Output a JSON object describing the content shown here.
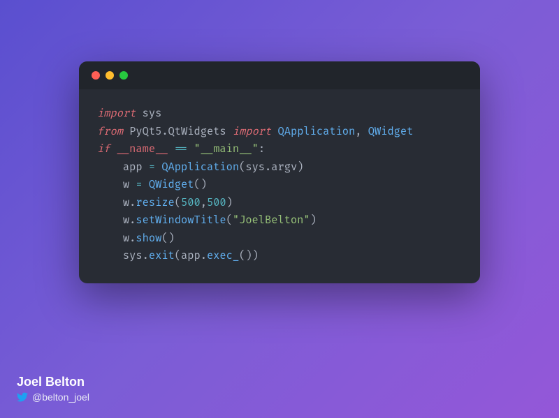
{
  "code": {
    "lines": [
      [
        {
          "t": "import",
          "c": "tok-kw"
        },
        {
          "t": " sys",
          "c": "tok-mod"
        }
      ],
      [
        {
          "t": "from",
          "c": "tok-kw"
        },
        {
          "t": " PyQt5.QtWidgets ",
          "c": "tok-mod"
        },
        {
          "t": "import",
          "c": "tok-kw"
        },
        {
          "t": " ",
          "c": "tok-mod"
        },
        {
          "t": "QApplication",
          "c": "tok-cls"
        },
        {
          "t": ", ",
          "c": "tok-punc"
        },
        {
          "t": "QWidget",
          "c": "tok-cls"
        }
      ],
      [
        {
          "t": "if",
          "c": "tok-kw"
        },
        {
          "t": " ",
          "c": "tok-mod"
        },
        {
          "t": "__name__",
          "c": "tok-dund"
        },
        {
          "t": " ",
          "c": "tok-mod"
        },
        {
          "t": "==",
          "c": "tok-op"
        },
        {
          "t": " ",
          "c": "tok-mod"
        },
        {
          "t": "\"__main__\"",
          "c": "tok-str"
        },
        {
          "t": ":",
          "c": "tok-punc"
        }
      ],
      [
        {
          "t": "    app ",
          "c": "tok-var"
        },
        {
          "t": "=",
          "c": "tok-op"
        },
        {
          "t": " ",
          "c": "tok-mod"
        },
        {
          "t": "QApplication",
          "c": "tok-cls"
        },
        {
          "t": "(sys.argv)",
          "c": "tok-punc"
        }
      ],
      [
        {
          "t": "    w ",
          "c": "tok-var"
        },
        {
          "t": "=",
          "c": "tok-op"
        },
        {
          "t": " ",
          "c": "tok-mod"
        },
        {
          "t": "QWidget",
          "c": "tok-cls"
        },
        {
          "t": "()",
          "c": "tok-punc"
        }
      ],
      [
        {
          "t": "    w.",
          "c": "tok-var"
        },
        {
          "t": "resize",
          "c": "tok-fn"
        },
        {
          "t": "(",
          "c": "tok-punc"
        },
        {
          "t": "500",
          "c": "tok-num"
        },
        {
          "t": ",",
          "c": "tok-punc"
        },
        {
          "t": "500",
          "c": "tok-num"
        },
        {
          "t": ")",
          "c": "tok-punc"
        }
      ],
      [
        {
          "t": "    w.",
          "c": "tok-var"
        },
        {
          "t": "setWindowTitle",
          "c": "tok-fn"
        },
        {
          "t": "(",
          "c": "tok-punc"
        },
        {
          "t": "\"JoelBelton\"",
          "c": "tok-str"
        },
        {
          "t": ")",
          "c": "tok-punc"
        }
      ],
      [
        {
          "t": "    w.",
          "c": "tok-var"
        },
        {
          "t": "show",
          "c": "tok-fn"
        },
        {
          "t": "()",
          "c": "tok-punc"
        }
      ],
      [
        {
          "t": "    sys.",
          "c": "tok-var"
        },
        {
          "t": "exit",
          "c": "tok-fn"
        },
        {
          "t": "(app.",
          "c": "tok-punc"
        },
        {
          "t": "exec_",
          "c": "tok-fn"
        },
        {
          "t": "())",
          "c": "tok-punc"
        }
      ]
    ]
  },
  "credit": {
    "name": "Joel Belton",
    "handle": "@belton_joel"
  }
}
